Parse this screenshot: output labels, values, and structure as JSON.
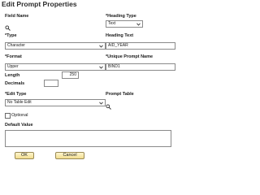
{
  "dialog": {
    "title": "Edit Prompt Properties"
  },
  "fields": {
    "field_name": {
      "label": "Field Name"
    },
    "heading_type": {
      "label": "*Heading Type",
      "value": "Text"
    },
    "type": {
      "label": "*Type",
      "value": "Character"
    },
    "heading_text": {
      "label": "Heading Text",
      "value": "AID_YEAR"
    },
    "format": {
      "label": "*Format",
      "value": "Upper"
    },
    "unique_prompt_name": {
      "label": "*Unique Prompt Name",
      "value": "BIND1"
    },
    "length": {
      "label": "Length",
      "value": "250"
    },
    "decimals": {
      "label": "Decimals",
      "value": ""
    },
    "edit_type": {
      "label": "*Edit Type",
      "value": "No Table Edit"
    },
    "prompt_table": {
      "label": "Prompt Table"
    },
    "optional": {
      "label": "Optional",
      "checked": false
    },
    "default_value": {
      "label": "Default Value",
      "value": ""
    }
  },
  "buttons": {
    "ok": "OK",
    "cancel": "Cancel"
  },
  "colors": {
    "button_bg": "#f2dd8e",
    "button_border": "#9a8a55"
  }
}
